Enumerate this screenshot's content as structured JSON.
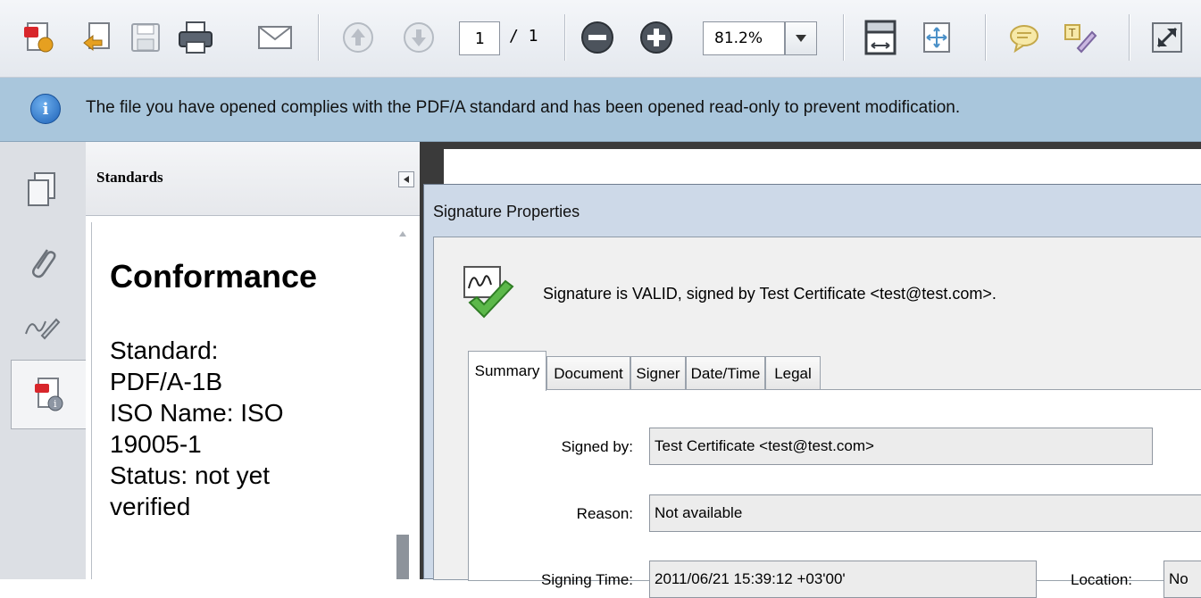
{
  "toolbar": {
    "page_current": "1",
    "page_total": "/ 1",
    "zoom": "81.2%",
    "buttons": [
      "create-icon",
      "combine-icon",
      "save-icon",
      "print-icon",
      "email-icon",
      "previous-page-icon",
      "next-page-icon",
      "zoom-out-icon",
      "zoom-in-icon",
      "fit-page-icon",
      "fit-width-icon",
      "comment-icon",
      "highlight-icon",
      "full-screen-icon"
    ]
  },
  "infobar": {
    "message": "The file you have opened complies with the PDF/A standard and has been opened read-only to prevent modification."
  },
  "panel": {
    "title": "Standards",
    "heading": "Conformance",
    "lines": [
      "Standard:",
      "PDF/A-1B",
      "ISO Name: ISO",
      "19005-1",
      "Status: not yet",
      "verified"
    ]
  },
  "dialog": {
    "title": "Signature Properties",
    "status": "Signature is VALID, signed by Test Certificate <test@test.com>.",
    "tabs": [
      "Summary",
      "Document",
      "Signer",
      "Date/Time",
      "Legal"
    ],
    "fields": {
      "signed_by_label": "Signed by:",
      "signed_by_value": "Test Certificate <test@test.com>",
      "reason_label": "Reason:",
      "reason_value": "Not available",
      "signing_time_label": "Signing Time:",
      "signing_time_value": "2011/06/21 15:39:12 +03'00'",
      "location_label": "Location:",
      "location_value": "No"
    }
  }
}
